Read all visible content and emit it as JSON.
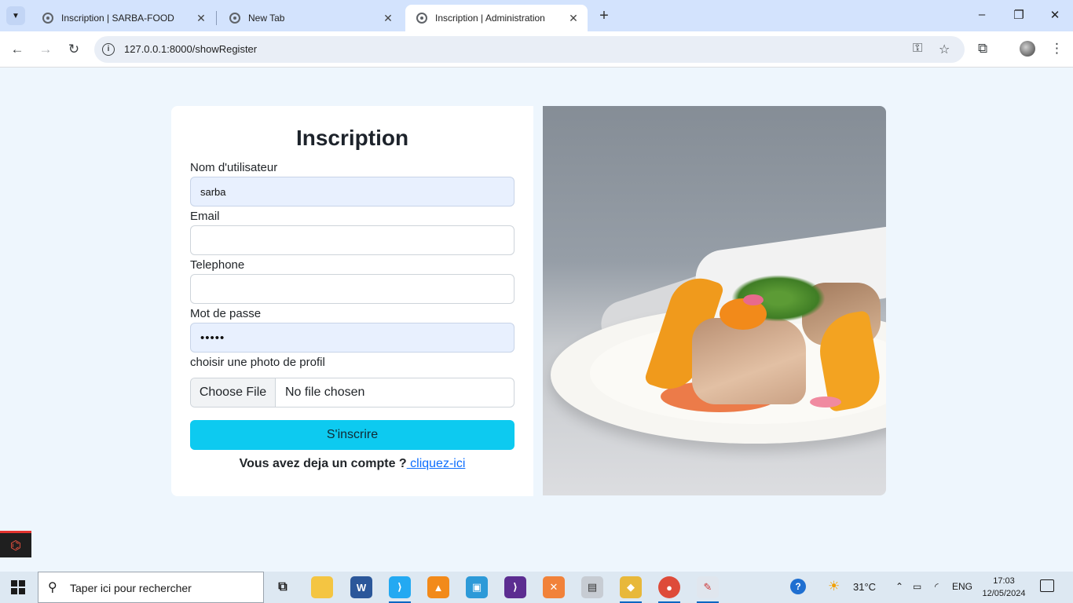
{
  "browser": {
    "tabs": [
      {
        "title": "Inscription | SARBA-FOOD",
        "active": false
      },
      {
        "title": "New Tab",
        "active": false
      },
      {
        "title": "Inscription | Administration",
        "active": true
      }
    ],
    "new_tab": "+",
    "url": "127.0.0.1:8000/showRegister",
    "window_controls": {
      "minimize": "–",
      "restore": "❐",
      "close": "✕"
    }
  },
  "form": {
    "title": "Inscription",
    "username_label": "Nom d'utilisateur",
    "username_value": "sarba",
    "email_label": "Email",
    "email_value": "",
    "phone_label": "Telephone",
    "phone_value": "",
    "password_label": "Mot de passe",
    "password_value": "•••••",
    "photo_label": "choisir une photo de profil",
    "file_button": "Choose File",
    "file_status": "No file chosen",
    "submit_label": "S'inscrire",
    "login_prompt": "Vous avez deja un compte ?",
    "login_link": " cliquez-ici"
  },
  "taskbar": {
    "search_placeholder": "Taper ici pour rechercher",
    "weather": "31°C",
    "language": "ENG",
    "time": "17:03",
    "date": "12/05/2024"
  },
  "colors": {
    "page_bg": "#eef6fd",
    "submit_bg": "#0dcaf0",
    "link": "#0d6efd",
    "autofill_bg": "#e8f0fe"
  }
}
